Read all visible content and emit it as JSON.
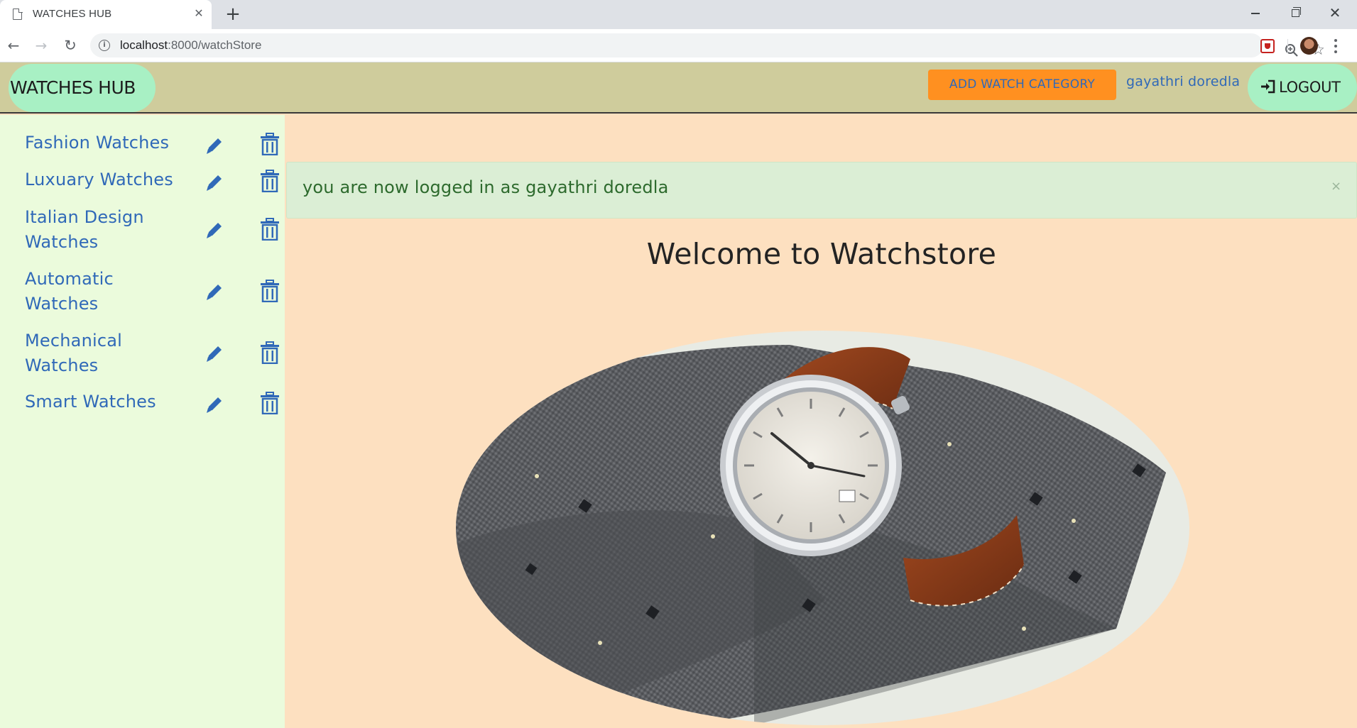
{
  "browser": {
    "tab_title": "WATCHES HUB",
    "tab_close": "✕",
    "new_tab": "+",
    "window_close": "✕",
    "url_host": "localhost",
    "url_path": ":8000/watchStore",
    "back": "←",
    "forward": "→",
    "reload": "↻",
    "star": "☆"
  },
  "navbar": {
    "brand": "WATCHES HUB",
    "add_category": "ADD WATCH CATEGORY",
    "user_name": "gayathri doredla",
    "logout": "LOGOUT"
  },
  "sidebar": {
    "categories": [
      {
        "label": "Fashion Watches"
      },
      {
        "label": "Luxuary Watches"
      },
      {
        "label": "Italian Design Watches"
      },
      {
        "label": "Automatic Watches"
      },
      {
        "label": "Mechanical Watches"
      },
      {
        "label": "Smart Watches"
      }
    ]
  },
  "main": {
    "alert_text": "you are now logged in as gayathri doredla",
    "alert_close": "×",
    "welcome": "Welcome to Watchstore"
  },
  "colors": {
    "link_blue": "#3069b8",
    "navbar_bg": "#cfcc9c",
    "page_bg": "#fde0c0",
    "sidebar_bg": "#ebfbdc",
    "accent_orange": "#ff9020",
    "pill_green": "#a8f0c4",
    "alert_bg": "#dbeed5"
  }
}
